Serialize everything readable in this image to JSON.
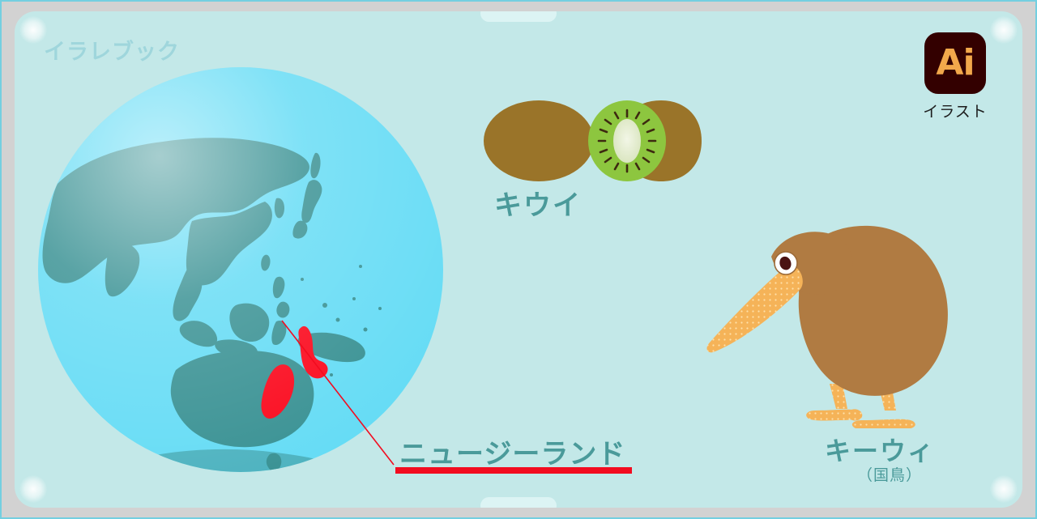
{
  "page": {
    "watermark": "イラレブック",
    "frame_color": "#d2d2d2",
    "panel_color": "#c3e8e8",
    "accent_teal": "#4a9a9a",
    "accent_red": "#f20c20"
  },
  "globe": {
    "name": "world-globe",
    "ocean_color": "#66dcf5",
    "land_color": "#3a9294",
    "highlight_country": "ニュージーランド",
    "highlight_color": "#fb0a1e"
  },
  "fruit": {
    "label": "キウイ",
    "whole_name": "kiwi-fruit-whole",
    "half_name": "kiwi-fruit-half",
    "skin_color": "#9a7429",
    "flesh_color": "#8dc63f",
    "core_color": "#dfe8c8",
    "seed_color": "#3d2a10"
  },
  "bird": {
    "label": "キーウィ",
    "sublabel": "（国鳥）",
    "body_color": "#b07b42",
    "beak_color": "#f5b358",
    "eye_white": "#ffffff",
    "eye_pupil": "#4a1212"
  },
  "callout": {
    "label": "ニュージーランド",
    "underline_color": "#f20c20",
    "leader_color": "#f20c20"
  },
  "badge": {
    "logo_text": "Ai",
    "caption": "イラスト",
    "bg_color": "#330000",
    "fg_color": "#f2a84b"
  }
}
